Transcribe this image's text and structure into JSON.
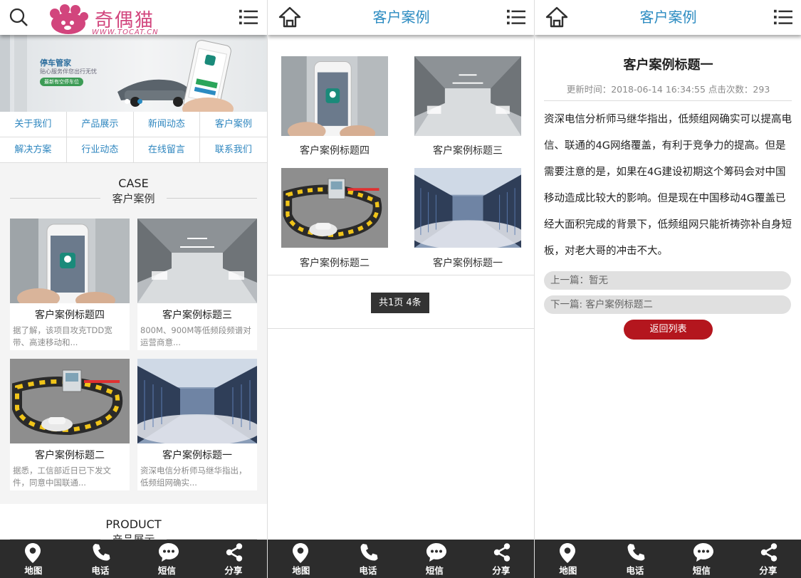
{
  "brand": {
    "name": "奇偶猫",
    "url": "WWW.TOCAT.CN"
  },
  "colors": {
    "accent": "#2b8bc1",
    "brand": "#d2457d",
    "button": "#b4161e",
    "footer": "#2c2c2c"
  },
  "banner": {
    "title": "停车管家",
    "subtitle": "贴心服务伴您出行无忧",
    "button": "最新有空停车位"
  },
  "nav": [
    "关于我们",
    "产品展示",
    "新闻动态",
    "客户案例",
    "解决方案",
    "行业动态",
    "在线留言",
    "联系我们"
  ],
  "case_section": {
    "en": "CASE",
    "cn": "客户案例"
  },
  "product_section": {
    "en": "PRODUCT",
    "cn": "产品展示"
  },
  "cases": [
    {
      "title": "客户案例标题四",
      "desc": "据了解，该项目攻克TDD宽带、高速移动和..."
    },
    {
      "title": "客户案例标题三",
      "desc": "800M、900M等低频段频谱对运营商意..."
    },
    {
      "title": "客户案例标题二",
      "desc": "据悉，工信部近日已下发文件，同意中国联通..."
    },
    {
      "title": "客户案例标题一",
      "desc": "资深电信分析师马继华指出，低频组网确实..."
    }
  ],
  "list_page": {
    "title": "客户案例",
    "pager": "共1页 4条"
  },
  "detail_page": {
    "title": "客户案例",
    "article_title": "客户案例标题一",
    "meta": "更新时间：2018-06-14 16:34:55  点击次数：293",
    "body": "资深电信分析师马继华指出，低频组网确实可以提高电信、联通的4G网络覆盖，有利于竞争力的提高。但是需要注意的是，如果在4G建设初期这个筹码会对中国移动造成比较大的影响。但是现在中国移动4G覆盖已经大面积完成的背景下，低频组网只能祈祷弥补自身短板，对老大哥的冲击不大。",
    "prev": "上一篇：暂无",
    "next": "下一篇: 客户案例标题二",
    "back": "返回列表"
  },
  "footer": [
    "地图",
    "电话",
    "短信",
    "分享"
  ]
}
